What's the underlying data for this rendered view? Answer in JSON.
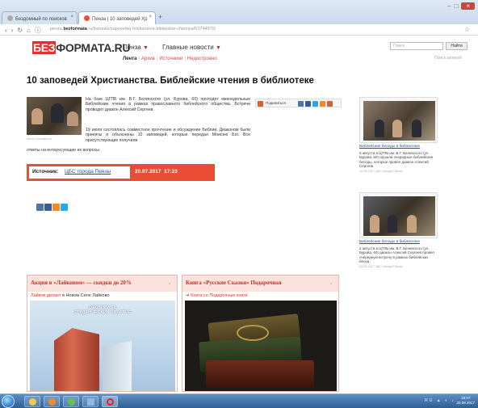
{
  "browser": {
    "tabs": [
      {
        "label": "Бездомный по поисков"
      },
      {
        "label": "Пенза | 10 заповедей Хр"
      }
    ],
    "address": {
      "prefix": "penza.",
      "host": "bezformata",
      "suffix": ".ru/listnews/zapovedej-hristianstva-bibliejskie-chteniya/63744970/"
    }
  },
  "site": {
    "logo_badge": "БЕЗ",
    "logo_rest": "ФОРМАТА.RU",
    "city": "Пенза",
    "main_news": "Главные новости",
    "subnav": {
      "lenta": "Лента",
      "archive": "Архив",
      "sources": "Источники",
      "nearby": "Недостроено"
    },
    "search_placeholder": "Поиск",
    "search_button": "Найти",
    "ext_search": "Поиск записей"
  },
  "article": {
    "title": "10 заповедей Христианства. Библейские чтения в библиотеке",
    "photo_caption": "Фото: penzalib.ru",
    "p1": "На базе ЦГПБ им. В.Г. Белинского (ул. Бурова, 60) проходят еженедельные Библейские чтения в рамках православного библейского общества. Встречи проводит диакон Алексий Сергеев.",
    "p2": "19 июля состоялась совместное прочтение и обсуждение Библии. Диаконом были приняты и объяснены 10 заповедей, которые передал Моисею Бог. Все присутствующие получили",
    "p3": "ответы на интересующие их вопросы.",
    "share_label": "Поделиться",
    "source_label": "Источник:",
    "source_link": "ЦБС города Пензы",
    "source_date": "20.07.2017",
    "source_time": "17:23"
  },
  "sidebar": [
    {
      "link": "Библейские беседы в библиотеке",
      "text": "5 августа в ЦГПБ им. В.Г. Белинского (ул. Бурова, 60) прошли очередные библейские беседы, которые провел диакон Алексий Сергеев.",
      "meta": "10.08.2017 ЦБС города Пензы"
    },
    {
      "link": "Библейские беседы в библиотеке",
      "text": "2 августа в ЦГПБ им. В.Г. Белинского (ул. Бурова, 60) диакон Алексий Сергеев провел очередную встречу в рамках библейских бесед.",
      "meta": "03.08.2017 ЦБС города Пензы"
    }
  ],
  "promos": [
    {
      "title": "Акция в «Лайковом» — скидки до 20%",
      "link": "Лайков делает",
      "sub": "в Новом Селе Лайково",
      "image_text_1": "ФЕСТИВАЛЬ",
      "image_text_2": "СТУДЕНЧЕСКИХ КВАРТИР"
    },
    {
      "title": "Книга «Русские Сказки» Подарочная",
      "link": "Книга со Подарочные книги"
    }
  ],
  "taskbar": {
    "tray_text": "RU",
    "time": "18:07",
    "date": "20.08.2017"
  }
}
